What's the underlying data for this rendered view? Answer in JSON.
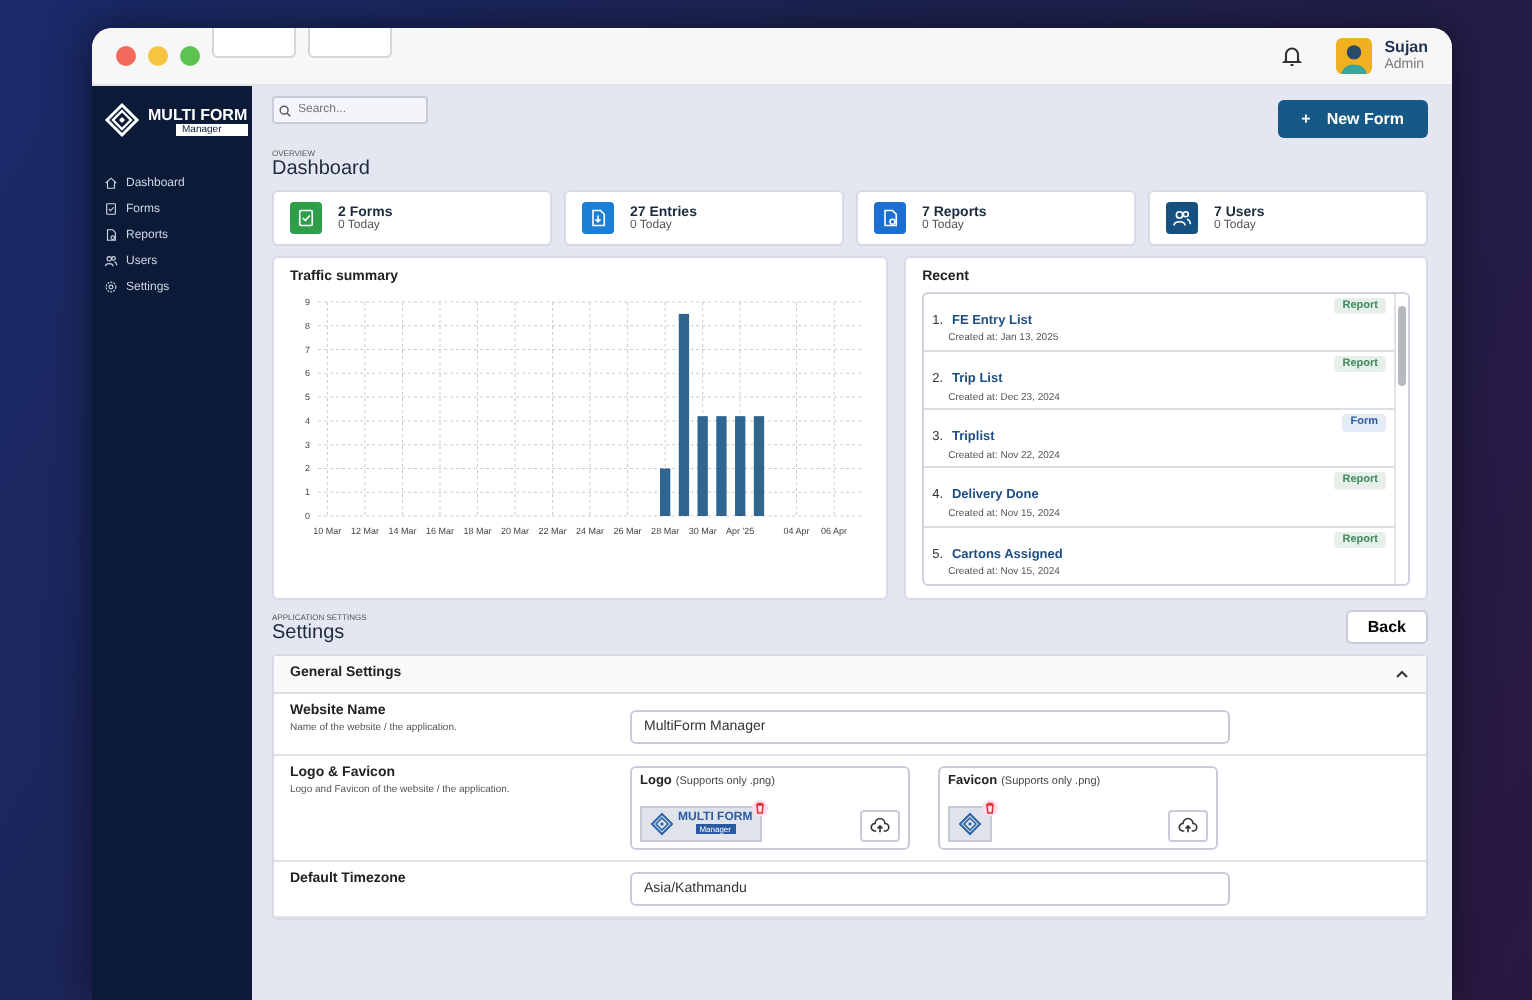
{
  "window": {
    "header": {
      "user": {
        "name": "Sujan",
        "role": "Admin"
      }
    }
  },
  "sidebar": {
    "brand": {
      "title": "MULTI FORM",
      "subtitle": "Manager"
    },
    "items": [
      {
        "label": "Dashboard"
      },
      {
        "label": "Forms"
      },
      {
        "label": "Reports"
      },
      {
        "label": "Users"
      },
      {
        "label": "Settings"
      }
    ]
  },
  "search": {
    "placeholder": "Search..."
  },
  "new_form_button": {
    "icon": "+",
    "label": "New Form"
  },
  "overview": {
    "eyebrow": "OVERVIEW",
    "title": "Dashboard"
  },
  "stats": [
    {
      "title": "2 Forms",
      "subtitle": "0 Today",
      "color": "#2e9e4a"
    },
    {
      "title": "27 Entries",
      "subtitle": "0 Today",
      "color": "#1a7fd6"
    },
    {
      "title": "7 Reports",
      "subtitle": "0 Today",
      "color": "#1a6fd0"
    },
    {
      "title": "7 Users",
      "subtitle": "0 Today",
      "color": "#155080"
    }
  ],
  "traffic": {
    "title": "Traffic summary",
    "chart_data": {
      "type": "bar",
      "grid": true,
      "categories": [
        "10 Mar",
        null,
        "12 Mar",
        null,
        "14 Mar",
        null,
        "16 Mar",
        null,
        "18 Mar",
        null,
        "20 Mar",
        null,
        "22 Mar",
        null,
        "24 Mar",
        null,
        "26 Mar",
        null,
        "28 Mar",
        null,
        "30 Mar",
        null,
        "Apr '25",
        null,
        null,
        "04 Apr",
        null,
        "06 Apr",
        null
      ],
      "series": [
        {
          "color": "#2f6690",
          "values": [
            null,
            null,
            null,
            null,
            null,
            null,
            null,
            null,
            null,
            null,
            null,
            null,
            null,
            null,
            null,
            null,
            null,
            null,
            2,
            8.5,
            4.2,
            4.2,
            4.2,
            4.2,
            null,
            null,
            null,
            null,
            null
          ]
        }
      ],
      "ylim": [
        0,
        9
      ],
      "yticks": [
        0,
        1,
        2,
        3,
        4,
        5,
        6,
        7,
        8,
        9
      ]
    }
  },
  "recent": {
    "title": "Recent",
    "items": [
      {
        "number": "1.",
        "name": "FE Entry List",
        "created": "Created at: Jan 13, 2025",
        "tag": "Report",
        "kind": "report"
      },
      {
        "number": "2.",
        "name": "Trip List",
        "created": "Created at: Dec 23, 2024",
        "tag": "Report",
        "kind": "report"
      },
      {
        "number": "3.",
        "name": "Triplist",
        "created": "Created at: Nov 22, 2024",
        "tag": "Form",
        "kind": "form"
      },
      {
        "number": "4.",
        "name": "Delivery Done",
        "created": "Created at: Nov 15, 2024",
        "tag": "Report",
        "kind": "report"
      },
      {
        "number": "5.",
        "name": "Cartons Assigned",
        "created": "Created at: Nov 15, 2024",
        "tag": "Report",
        "kind": "report"
      }
    ]
  },
  "settings": {
    "eyebrow": "APPLICATION SETTINGS",
    "title": "Settings",
    "back_button": "Back",
    "section": {
      "title": "General Settings",
      "expanded": true,
      "rows": [
        {
          "kind": "text",
          "label": "Website Name",
          "description": "Name of the website / the application.",
          "value": "MultiForm Manager"
        },
        {
          "kind": "uploads",
          "label": "Logo & Favicon",
          "description": "Logo and Favicon of the website / the application.",
          "uploads": [
            {
              "label": "Logo",
              "hint": "(Supports only .png)",
              "kind": "logo",
              "preview_title": "MULTI FORM",
              "preview_subtitle": "Manager"
            },
            {
              "label": "Favicon",
              "hint": "(Supports only .png)",
              "kind": "favicon"
            }
          ]
        },
        {
          "kind": "select",
          "label": "Default Timezone",
          "value": "Asia/Kathmandu"
        }
      ]
    }
  }
}
